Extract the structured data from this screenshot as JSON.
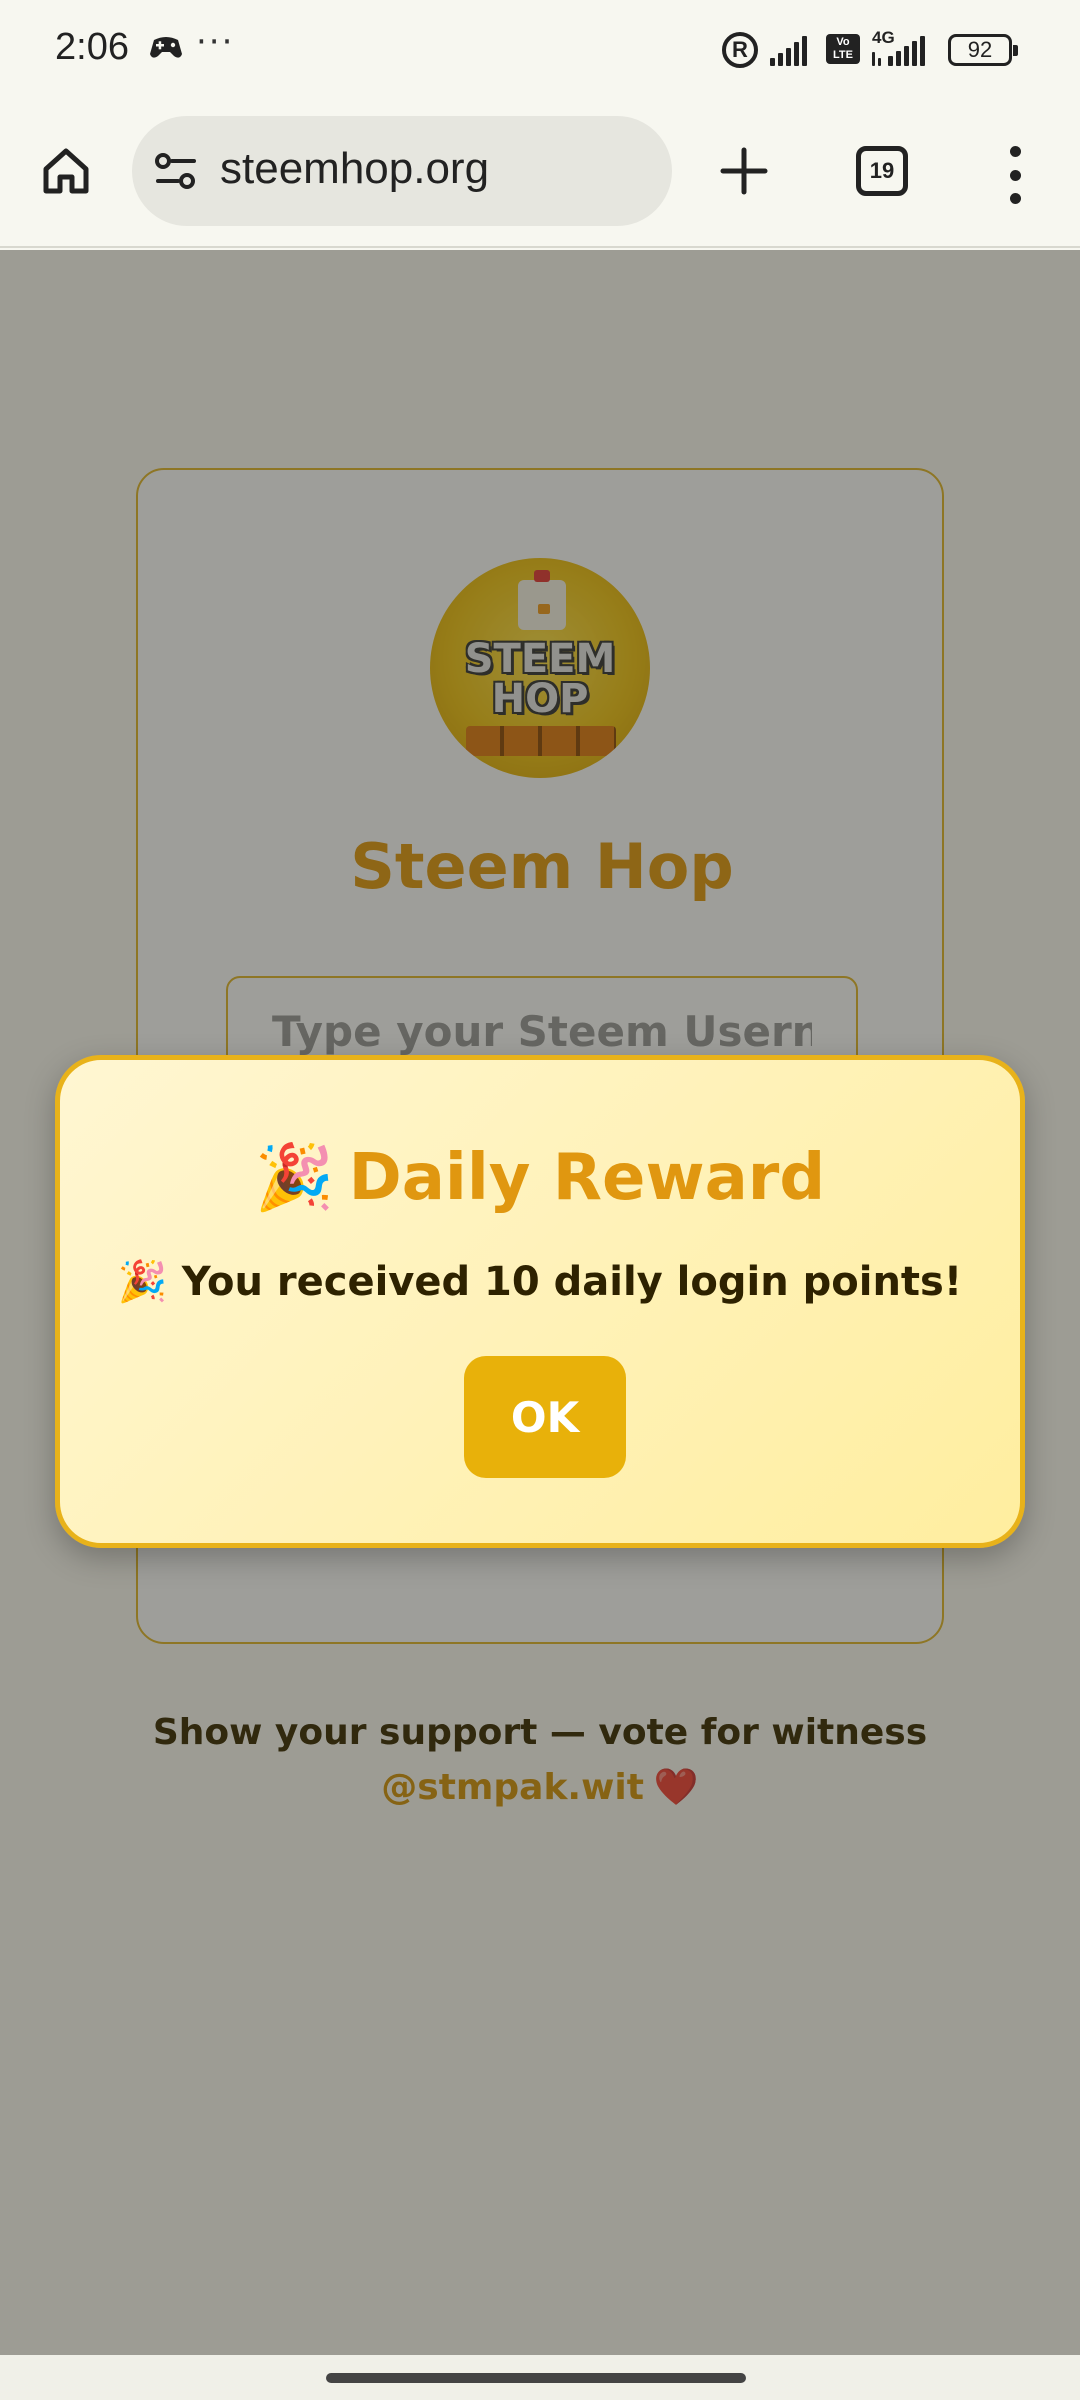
{
  "status_bar": {
    "time": "2:06",
    "overflow": "···",
    "registered_mark": "R",
    "volte_label": "Vo\nLTE",
    "network_type": "4G",
    "battery_level": "92",
    "icons": [
      "game-controller-icon",
      "registered-icon",
      "signal-icon",
      "volte-icon",
      "signal-4g-icon",
      "battery-icon"
    ]
  },
  "browser": {
    "url": "steemhop.org",
    "tab_count": "19",
    "icons": [
      "home-icon",
      "site-settings-icon",
      "plus-icon",
      "tabs-icon",
      "more-vert-icon"
    ]
  },
  "login": {
    "logo_line1": "STEEM",
    "logo_line2": "HOP",
    "title": "Steem Hop",
    "username_placeholder": "Type your Steem Username"
  },
  "support": {
    "text": "Show your support — vote for witness",
    "witness_link": "@stmpak.wit",
    "heart": "❤️"
  },
  "modal": {
    "emoji": "🎉",
    "title": "Daily Reward",
    "message": "You received 10 daily login points!",
    "ok_label": "OK"
  },
  "colors": {
    "accent": "#e09710",
    "button": "#e8b10a",
    "modal_border": "#e8b21a",
    "modal_bg_start": "#fff6d2",
    "modal_bg_end": "#ffee9f"
  }
}
